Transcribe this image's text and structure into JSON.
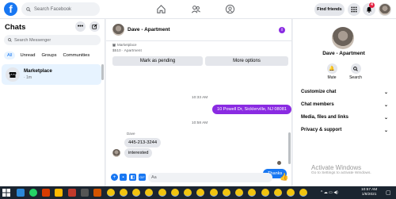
{
  "topbar": {
    "search_placeholder": "Search Facebook",
    "find_friends": "Find friends",
    "notification_count": "4"
  },
  "sidebar": {
    "title": "Chats",
    "search_placeholder": "Search Messenger",
    "filters": [
      "All",
      "Unread",
      "Groups",
      "Communities"
    ],
    "conversation": {
      "name": "Marketplace",
      "subtitle": "· 1m"
    }
  },
  "conversation": {
    "title": "Dave - Apartment",
    "marketplace_label": "Marketplace",
    "price": "$510 · Apartment",
    "mark_pending": "Mark as pending",
    "more_options": "More options",
    "messages": {
      "time1": "10:33 AM",
      "out1": "10 Powell Dr, Sicklerville, NJ 08081",
      "time2": "10:58 AM",
      "sender": "Dave",
      "in1": "445-213-3244",
      "in2": "interested",
      "out2": "Thanks"
    },
    "composer_placeholder": "Aa"
  },
  "details": {
    "name": "Dave - Apartment",
    "mute": "Mute",
    "search": "Search",
    "sections": [
      "Customize chat",
      "Chat members",
      "Media, files and links",
      "Privacy & support"
    ]
  },
  "watermark": {
    "title": "Activate Windows",
    "subtitle": "Go to Settings to activate Windows."
  },
  "taskbar": {
    "time": "10:57 AM",
    "date": "1/8/2021"
  },
  "colors": {
    "accent_purple": "#8a2be2",
    "facebook_blue": "#1877f2"
  }
}
